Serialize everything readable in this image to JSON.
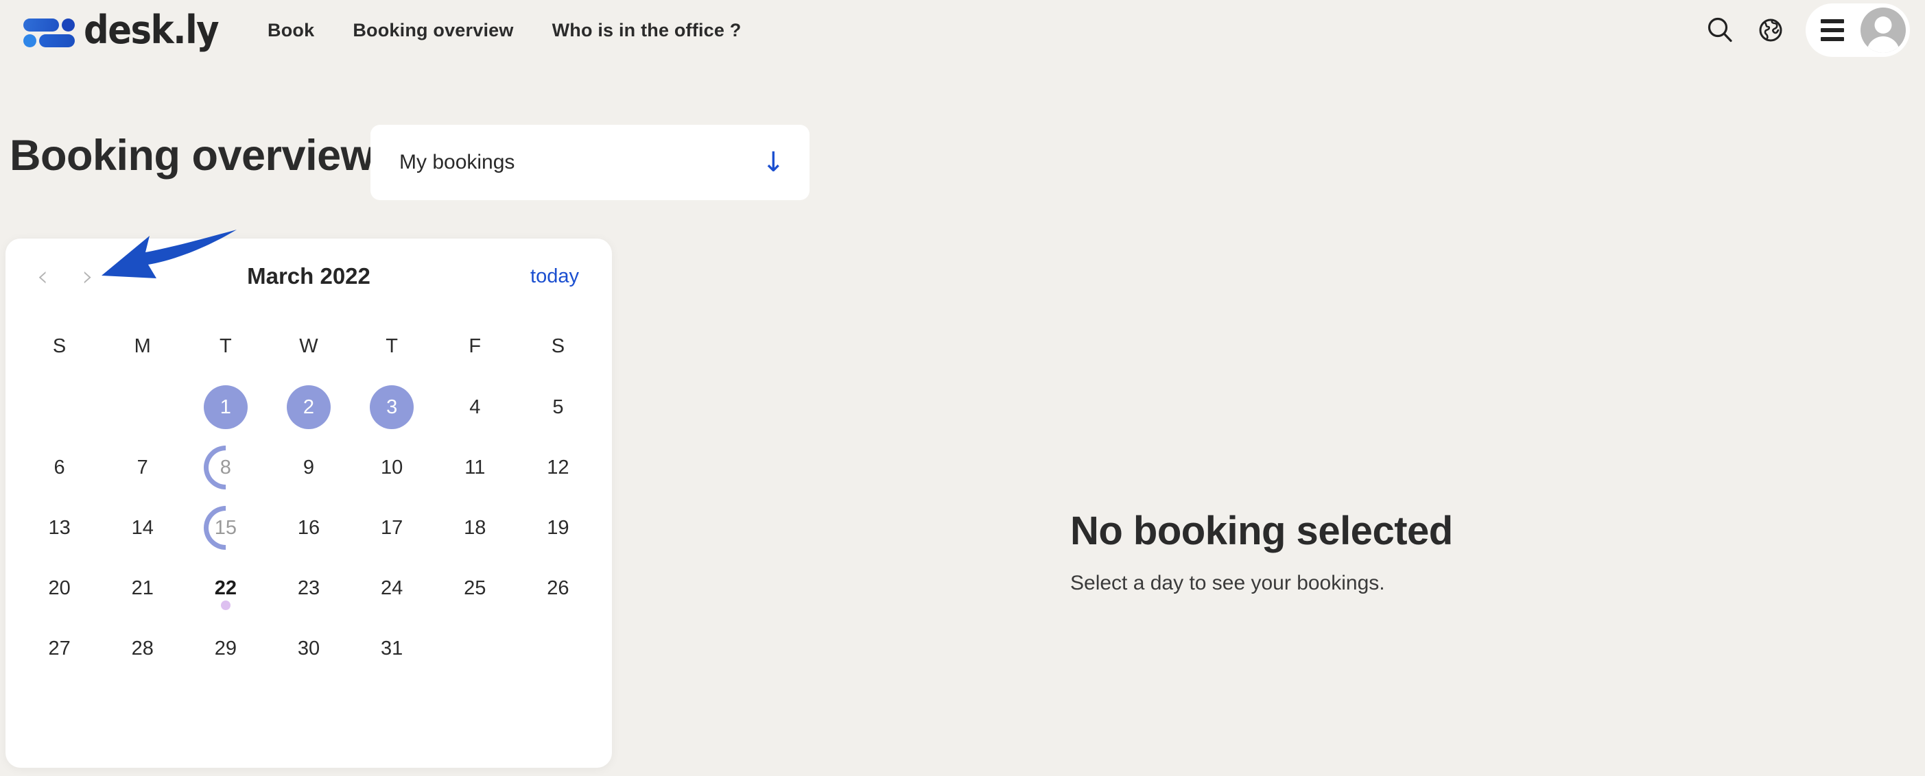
{
  "brand": {
    "name": "desk.ly",
    "logo_icon": "deskly-dots-logo",
    "accent_blue": "#1b4fd0",
    "logo_blue": "#1f52c4"
  },
  "header": {
    "nav": [
      {
        "label": "Book",
        "name": "nav-book"
      },
      {
        "label": "Booking overview",
        "name": "nav-booking-overview"
      },
      {
        "label": "Who is in the office ?",
        "name": "nav-who-is-in-the-office"
      }
    ],
    "actions": {
      "search_icon": "search-icon",
      "language_icon": "globe-icon",
      "menu_icon": "hamburger-menu-icon",
      "avatar_icon": "user-avatar"
    }
  },
  "page": {
    "title": "Booking overview",
    "filter": {
      "selected": "My bookings",
      "arrow_icon": "arrow-down-icon"
    }
  },
  "calendar": {
    "month_title": "March 2022",
    "prev_label": "‹",
    "next_label": "›",
    "today_label": "today",
    "weekdays": [
      "S",
      "M",
      "T",
      "W",
      "T",
      "F",
      "S"
    ],
    "weeks": [
      [
        {
          "day": "",
          "state": "empty"
        },
        {
          "day": "",
          "state": "empty"
        },
        {
          "day": "1",
          "state": "filled"
        },
        {
          "day": "2",
          "state": "filled"
        },
        {
          "day": "3",
          "state": "filled"
        },
        {
          "day": "4",
          "state": "normal"
        },
        {
          "day": "5",
          "state": "normal"
        }
      ],
      [
        {
          "day": "6",
          "state": "normal"
        },
        {
          "day": "7",
          "state": "normal"
        },
        {
          "day": "8",
          "state": "ring"
        },
        {
          "day": "9",
          "state": "normal"
        },
        {
          "day": "10",
          "state": "normal"
        },
        {
          "day": "11",
          "state": "normal"
        },
        {
          "day": "12",
          "state": "normal"
        }
      ],
      [
        {
          "day": "13",
          "state": "normal"
        },
        {
          "day": "14",
          "state": "normal"
        },
        {
          "day": "15",
          "state": "ring"
        },
        {
          "day": "16",
          "state": "normal"
        },
        {
          "day": "17",
          "state": "normal"
        },
        {
          "day": "18",
          "state": "normal"
        },
        {
          "day": "19",
          "state": "normal"
        }
      ],
      [
        {
          "day": "20",
          "state": "normal"
        },
        {
          "day": "21",
          "state": "normal"
        },
        {
          "day": "22",
          "state": "today"
        },
        {
          "day": "23",
          "state": "normal"
        },
        {
          "day": "24",
          "state": "normal"
        },
        {
          "day": "25",
          "state": "normal"
        },
        {
          "day": "26",
          "state": "normal"
        }
      ],
      [
        {
          "day": "27",
          "state": "normal"
        },
        {
          "day": "28",
          "state": "normal"
        },
        {
          "day": "29",
          "state": "normal"
        },
        {
          "day": "30",
          "state": "normal"
        },
        {
          "day": "31",
          "state": "normal"
        },
        {
          "day": "",
          "state": "empty"
        },
        {
          "day": "",
          "state": "empty"
        }
      ]
    ],
    "selected_day_color": "#8f9bdb",
    "today_dot_color": "#ddc0f0"
  },
  "detail_panel": {
    "title": "No booking selected",
    "subtitle": "Select a day to see your bookings."
  },
  "annotation": {
    "arrow_icon": "pointer-arrow-annotation",
    "color": "#1a4fc4",
    "points_to": "next-month-chevron"
  }
}
